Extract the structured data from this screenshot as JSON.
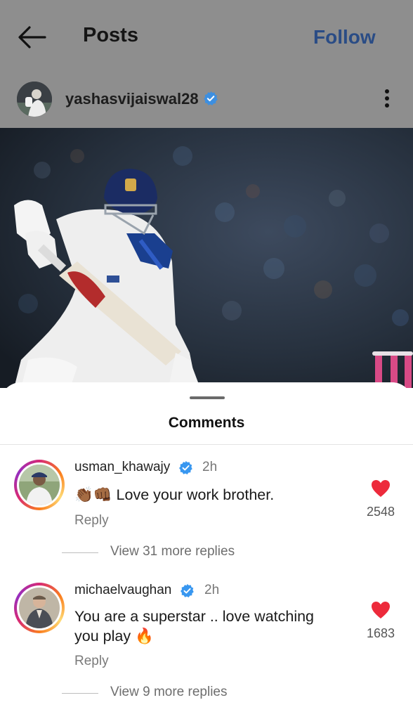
{
  "header": {
    "title": "Posts",
    "follow_label": "Follow"
  },
  "post": {
    "username": "yashasvijaiswal28"
  },
  "comments_sheet": {
    "title": "Comments",
    "comments": [
      {
        "username": "usman_khawajy",
        "time": "2h",
        "emoji": "👏🏾👊🏾",
        "text": "Love your work brother.",
        "reply_label": "Reply",
        "likes": "2548",
        "view_replies": "View 31 more replies"
      },
      {
        "username": "michaelvaughan",
        "time": "2h",
        "text_line1": "You are a superstar .. love watching",
        "text_line2": "you play 🔥",
        "reply_label": "Reply",
        "likes": "1683",
        "view_replies": "View 9 more replies"
      }
    ]
  },
  "colors": {
    "follow": "#2a4c85",
    "verified": "#3897f0",
    "heart": "#ed2a3b",
    "dim_overlay": "#8e8e8e"
  }
}
